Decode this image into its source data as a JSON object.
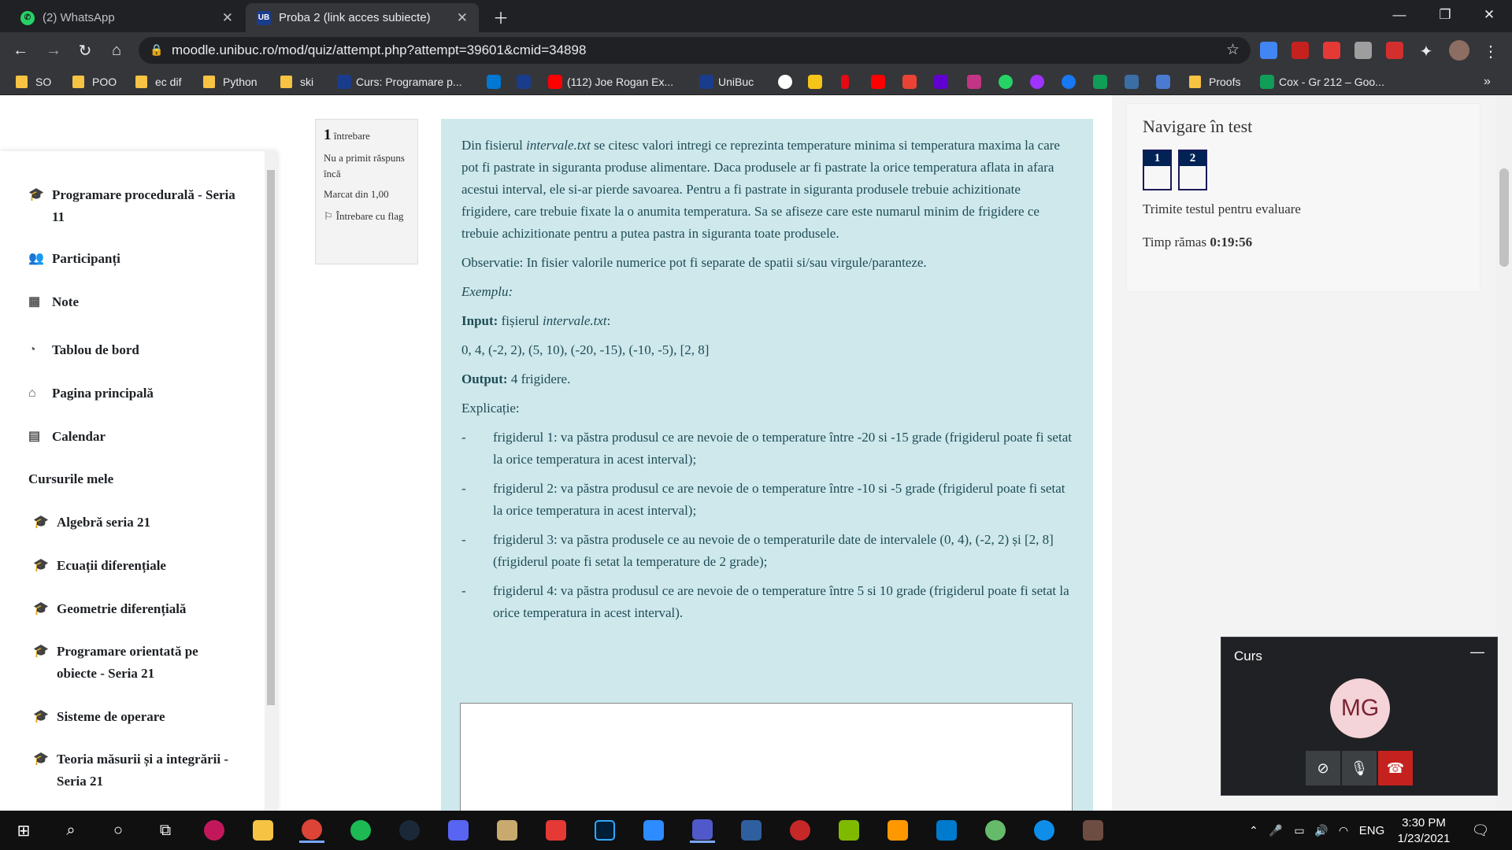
{
  "tabs": [
    {
      "label": "(2) WhatsApp",
      "favicon": "whatsapp-icon",
      "favicon_color": "#25d366"
    },
    {
      "label": "Proba 2 (link acces subiecte)",
      "favicon": "unibuc-icon",
      "favicon_color": "#1a3c8c"
    }
  ],
  "address": {
    "url": "moodle.unibuc.ro/mod/quiz/attempt.php?attempt=39601&cmid=34898"
  },
  "bookmarks": [
    {
      "label": "SO",
      "type": "folder"
    },
    {
      "label": "POO",
      "type": "folder"
    },
    {
      "label": "ec dif",
      "type": "folder"
    },
    {
      "label": "Python",
      "type": "folder"
    },
    {
      "label": "ski",
      "type": "folder"
    },
    {
      "label": "Curs: Programare p...",
      "type": "site",
      "color": "#1a3c8c"
    },
    {
      "label": "(112) Joe Rogan Ex...",
      "type": "site",
      "color": "#ff0000"
    },
    {
      "label": "UniBuc",
      "type": "site",
      "color": "#1a3c8c"
    },
    {
      "label": "Proofs",
      "type": "folder"
    },
    {
      "label": "Cox - Gr 212 – Goo...",
      "type": "site",
      "color": "#0f9d58"
    }
  ],
  "drawer": {
    "items": [
      {
        "label": "Programare procedurală - Seria 11",
        "icon": "graduation-cap-icon"
      },
      {
        "label": "Participanți",
        "icon": "users-icon"
      },
      {
        "label": "Note",
        "icon": "table-icon"
      },
      {
        "label": "Tablou de bord",
        "icon": "dashboard-icon"
      },
      {
        "label": "Pagina principală",
        "icon": "home-icon"
      },
      {
        "label": "Calendar",
        "icon": "calendar-icon"
      }
    ],
    "section_title": "Cursurile mele",
    "courses": [
      {
        "label": "Algebră seria 21",
        "icon": "graduation-cap-icon"
      },
      {
        "label": "Ecuații diferențiale",
        "icon": "graduation-cap-icon"
      },
      {
        "label": "Geometrie diferențială",
        "icon": "graduation-cap-icon"
      },
      {
        "label": "Programare orientată pe obiecte - Seria 21",
        "icon": "graduation-cap-icon"
      },
      {
        "label": "Sisteme de operare",
        "icon": "graduation-cap-icon"
      },
      {
        "label": "Teoria măsurii și a integrării - Seria 21",
        "icon": "graduation-cap-icon"
      }
    ]
  },
  "question_info": {
    "number": "1",
    "number_label": "întrebare",
    "status": "Nu a primit răspuns încă",
    "mark": "Marcat din 1,00",
    "flag_label": "Întrebare cu flag"
  },
  "question": {
    "intro_a": "Din fisierul ",
    "intro_file": "intervale.txt",
    "intro_b": " se citesc valori intregi ce reprezinta temperature minima si temperatura maxima la care pot fi pastrate in siguranta produse alimentare. Daca produsele ar fi pastrate la orice temperatura aflata in afara acestui interval, ele si-ar pierde savoarea. Pentru a fi pastrate in siguranta produsele trebuie achizitionate frigidere, care trebuie fixate la o anumita temperatura. Sa se afiseze care este numarul minim de frigidere ce trebuie achizitionate pentru a putea pastra in siguranta toate produsele.",
    "observation": "Observatie: In fisier valorile numerice pot fi separate de spatii si/sau virgule/paranteze.",
    "example_label": "Exemplu:",
    "input_label": "Input:",
    "input_text_a": " fișierul ",
    "input_file": "intervale.txt",
    "input_text_b": ":",
    "input_values": "0, 4,  (-2, 2), (5, 10), (-20, -15), (-10, -5), [2, 8]",
    "output_label": "Output:",
    "output_value": " 4 frigidere.",
    "explanation_label": "Explicație:",
    "explanations": [
      {
        "dash": "-",
        "text": "frigiderul 1: va păstra produsul ce are nevoie de o temperature între -20 si -15 grade (frigiderul poate fi setat la orice temperatura in acest interval);"
      },
      {
        "dash": "-",
        "text": "frigiderul 2: va păstra produsul ce are nevoie de o temperature între -10 si -5 grade (frigiderul poate fi setat la orice temperatura in acest interval);"
      },
      {
        "dash": "-",
        "text": "frigiderul 3: va păstra produsele ce au nevoie de o temperaturile date de intervalele (0, 4), (-2, 2) și [2, 8] (frigiderul poate fi setat la temperature de 2 grade);"
      },
      {
        "dash": "-",
        "text": "frigiderul 4: va păstra produsul ce are nevoie de o temperature între 5 si 10 grade (frigiderul poate fi setat la orice temperatura in acest interval)."
      }
    ],
    "answer_value": ""
  },
  "quiz_nav": {
    "title": "Navigare în test",
    "buttons": [
      "1",
      "2"
    ],
    "send_link": "Trimite testul pentru evaluare",
    "time_label": "Timp rămas ",
    "time_value": "0:19:56"
  },
  "meet": {
    "title": "Curs",
    "initials": "MG",
    "avatar_color": "#f4d4d8",
    "end_color": "#c5221f"
  },
  "taskbar": {
    "language": "ENG",
    "time": "3:30 PM",
    "date": "1/23/2021"
  },
  "colors": {
    "question_bg": "#cee8ec",
    "quiz_nav_btn": "#002255",
    "chrome_dark": "#202124"
  }
}
